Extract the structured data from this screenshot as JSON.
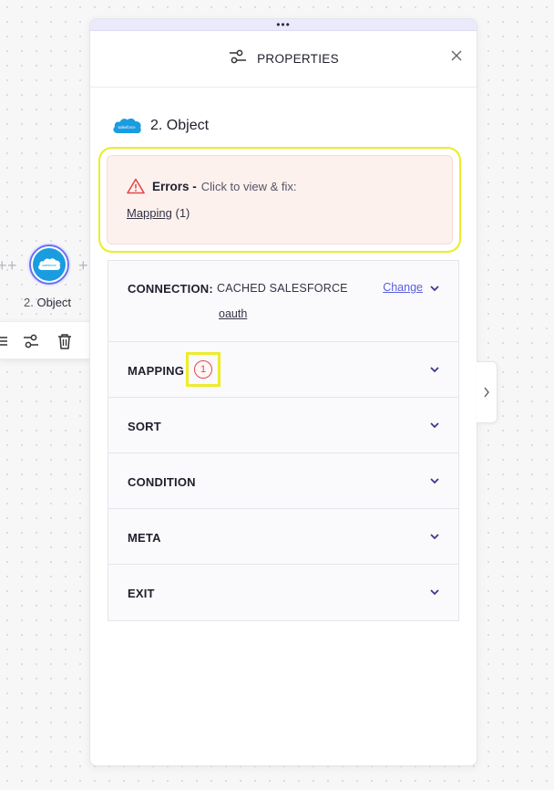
{
  "canvas": {
    "node": {
      "number": "2.",
      "label": "Object",
      "icon": "salesforce-icon"
    },
    "toolbar_icons": [
      "list-icon",
      "settings-sliders-icon",
      "trash-icon"
    ]
  },
  "panel": {
    "title": "PROPERTIES",
    "header_icon": "settings-sliders-icon",
    "object": {
      "number": "2.",
      "name": "Object"
    },
    "errors": {
      "title": "Errors -",
      "subtitle": "Click to view & fix:",
      "items": [
        {
          "label": "Mapping",
          "count": "(1)"
        }
      ]
    },
    "sections": {
      "connection": {
        "label": "CONNECTION:",
        "value": "CACHED SALESFORCE",
        "sub_value": "oauth",
        "change_label": "Change"
      },
      "mapping": {
        "label": "MAPPING",
        "badge": "1"
      },
      "sort": {
        "label": "SORT"
      },
      "condition": {
        "label": "CONDITION"
      },
      "meta": {
        "label": "META"
      },
      "exit": {
        "label": "EXIT"
      }
    }
  },
  "colors": {
    "accent": "#5a5fe0",
    "error": "#e04a4a",
    "error_bg": "#fdf1ee",
    "highlight": "#ecec2c",
    "salesforce_blue": "#1a9ce0"
  }
}
